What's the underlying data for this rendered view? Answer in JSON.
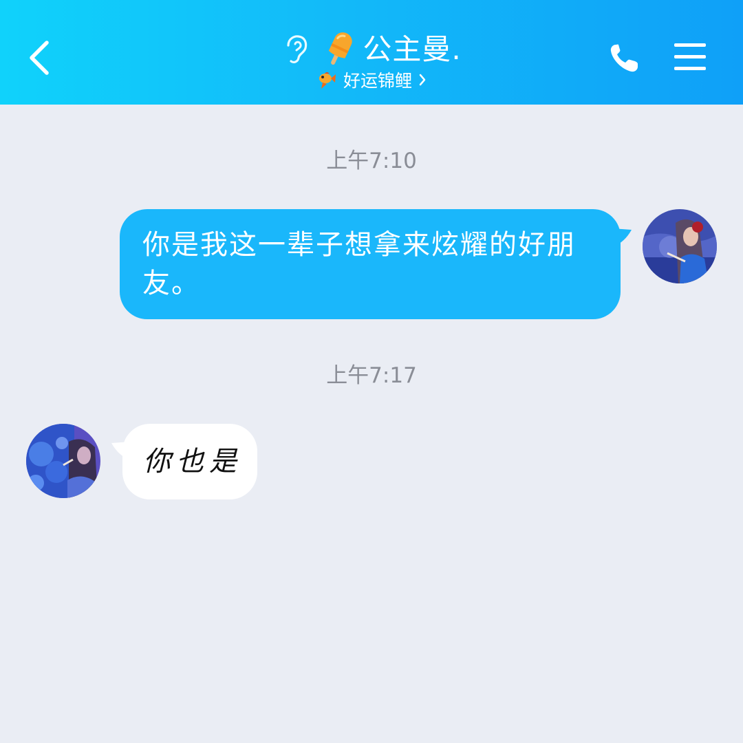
{
  "header": {
    "title": "公主曼.",
    "subtitle": "好运锦鲤",
    "icons": {
      "back": "chevron-left-icon",
      "ear": "ear-icon",
      "badge": "popsicle-icon",
      "subtitle_badge": "koi-fish-icon",
      "call": "phone-icon",
      "menu": "menu-icon"
    },
    "colors": {
      "gradient_start": "#10d2fb",
      "gradient_end": "#0fa0f8"
    }
  },
  "messages": [
    {
      "timestamp": "上午7:10",
      "direction": "outgoing",
      "text": "你是我这一辈子想拿来炫耀的好朋友。"
    },
    {
      "timestamp": "上午7:17",
      "direction": "incoming",
      "text": "你也是"
    }
  ],
  "colors": {
    "background": "#eaedf4",
    "outgoing_bubble": "#1ab7fb",
    "incoming_bubble": "#ffffff",
    "timestamp": "#8a8d96"
  }
}
